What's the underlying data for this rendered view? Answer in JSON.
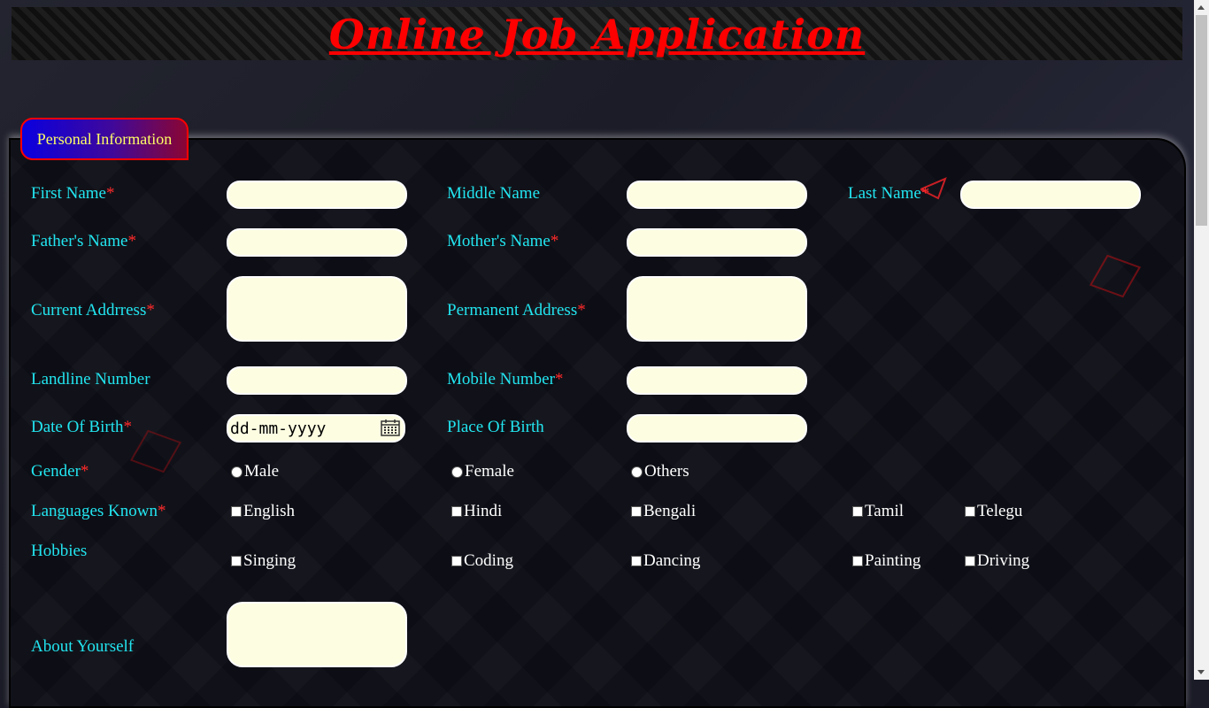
{
  "header": {
    "title": "Online Job Application"
  },
  "section": {
    "legend": "Personal Information"
  },
  "fields": {
    "first_name": "First Name",
    "middle_name": "Middle Name",
    "last_name": "Last Name",
    "father_name": "Father's Name",
    "mother_name": "Mother's Name",
    "current_address": "Current Addrress",
    "permanent_address": "Permanent Address",
    "landline": "Landline Number",
    "mobile": "Mobile Number",
    "dob": "Date Of Birth",
    "place_of_birth": "Place Of Birth",
    "gender": "Gender",
    "languages": "Languages Known",
    "hobbies": "Hobbies",
    "about": "About Yourself"
  },
  "required_mark": "*",
  "dob_placeholder": "dd-mm-yyyy",
  "gender_options": [
    "Male",
    "Female",
    "Others"
  ],
  "language_options": [
    "English",
    "Hindi",
    "Bengali",
    "Tamil",
    "Telegu"
  ],
  "hobby_options": [
    "Singing",
    "Coding",
    "Dancing",
    "Painting",
    "Driving"
  ],
  "colors": {
    "label": "#22e5f0",
    "required": "#ff2a2a",
    "title": "#ff0000",
    "input_bg": "#fdfde2"
  },
  "icons": [
    "calendar-icon"
  ]
}
